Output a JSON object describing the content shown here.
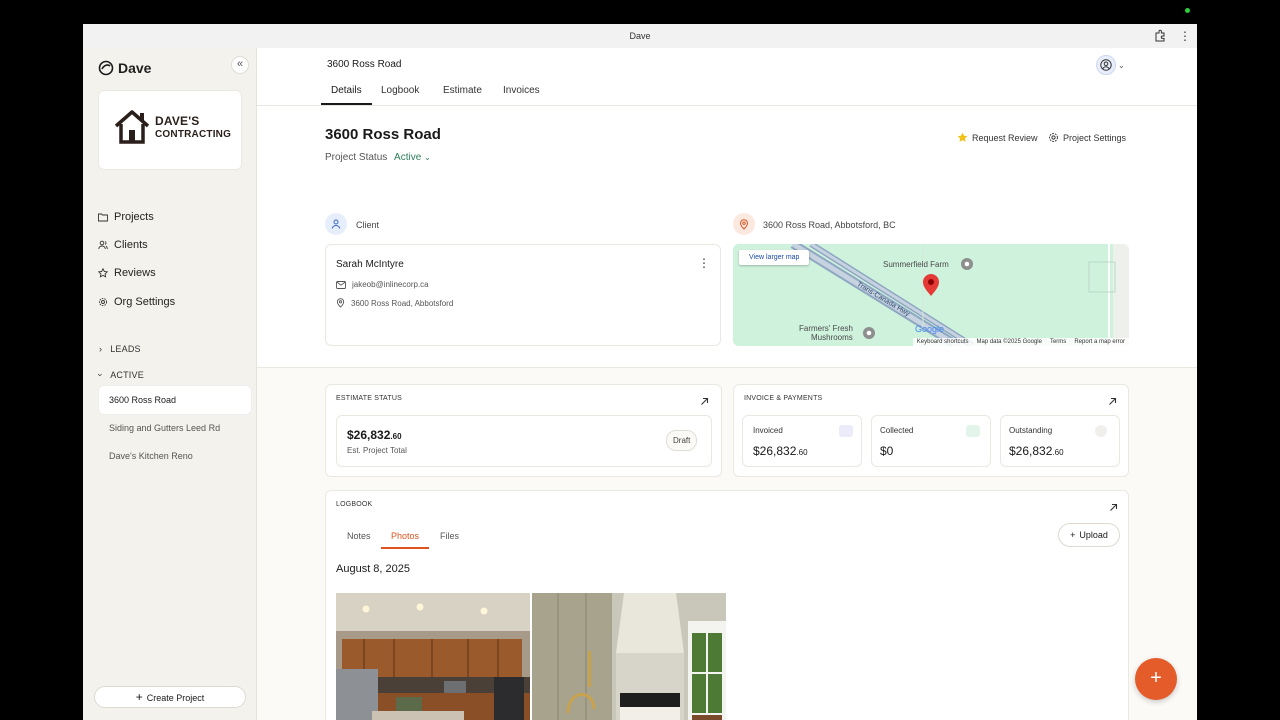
{
  "window": {
    "title": "Dave"
  },
  "sidebar": {
    "brand": "Dave",
    "collapse_icon": "double-chevron-left-icon",
    "logo_text_line1": "DAVE'S",
    "logo_text_line2": "CONTRACTING",
    "nav": [
      {
        "label": "Projects",
        "icon": "folder-icon"
      },
      {
        "label": "Clients",
        "icon": "users-icon"
      },
      {
        "label": "Reviews",
        "icon": "star-icon"
      },
      {
        "label": "Org Settings",
        "icon": "gear-icon"
      }
    ],
    "sections": {
      "leads": "LEADS",
      "active": "ACTIVE"
    },
    "projects": [
      "3600 Ross Road",
      "Siding and Gutters Leed Rd",
      "Dave's Kitchen Reno"
    ],
    "create_label": "Create Project"
  },
  "header": {
    "title": "3600 Ross Road",
    "tabs": [
      "Details",
      "Logbook",
      "Estimate",
      "Invoices"
    ],
    "active_tab": "Details"
  },
  "project": {
    "title": "3600 Ross Road",
    "status_label": "Project Status",
    "status_value": "Active",
    "request_review": "Request Review",
    "project_settings": "Project Settings",
    "client_label": "Client",
    "address_label": "3600 Ross Road, Abbotsford, BC",
    "client": {
      "name": "Sarah McIntyre",
      "email": "jakeob@inlinecorp.ca",
      "address": "3600 Ross Road, Abbotsford"
    }
  },
  "map": {
    "link": "View larger map",
    "labels": [
      "Summerfield Farm",
      "Trans-Canada Hwy",
      "Farmers' Fresh",
      "Mushrooms",
      "Google"
    ],
    "footer": [
      "Keyboard shortcuts",
      "Map data ©2025 Google",
      "Terms",
      "Report a map error"
    ]
  },
  "estimate": {
    "title": "ESTIMATE STATUS",
    "amount_main": "$26,832",
    "amount_cents": ".60",
    "subtitle": "Est. Project Total",
    "badge": "Draft"
  },
  "invoices": {
    "title": "INVOICE & PAYMENTS",
    "items": [
      {
        "label": "Invoiced",
        "main": "$26,832",
        "cents": ".60"
      },
      {
        "label": "Collected",
        "main": "$0",
        "cents": ""
      },
      {
        "label": "Outstanding",
        "main": "$26,832",
        "cents": ".60"
      }
    ]
  },
  "logbook": {
    "title": "LOGBOOK",
    "tabs": [
      "Notes",
      "Photos",
      "Files"
    ],
    "active_tab": "Photos",
    "upload": "Upload",
    "date": "August 8, 2025"
  },
  "colors": {
    "accent": "#e45c2a",
    "active_status": "#2e7d5b",
    "map_bg": "#cff2dd"
  }
}
